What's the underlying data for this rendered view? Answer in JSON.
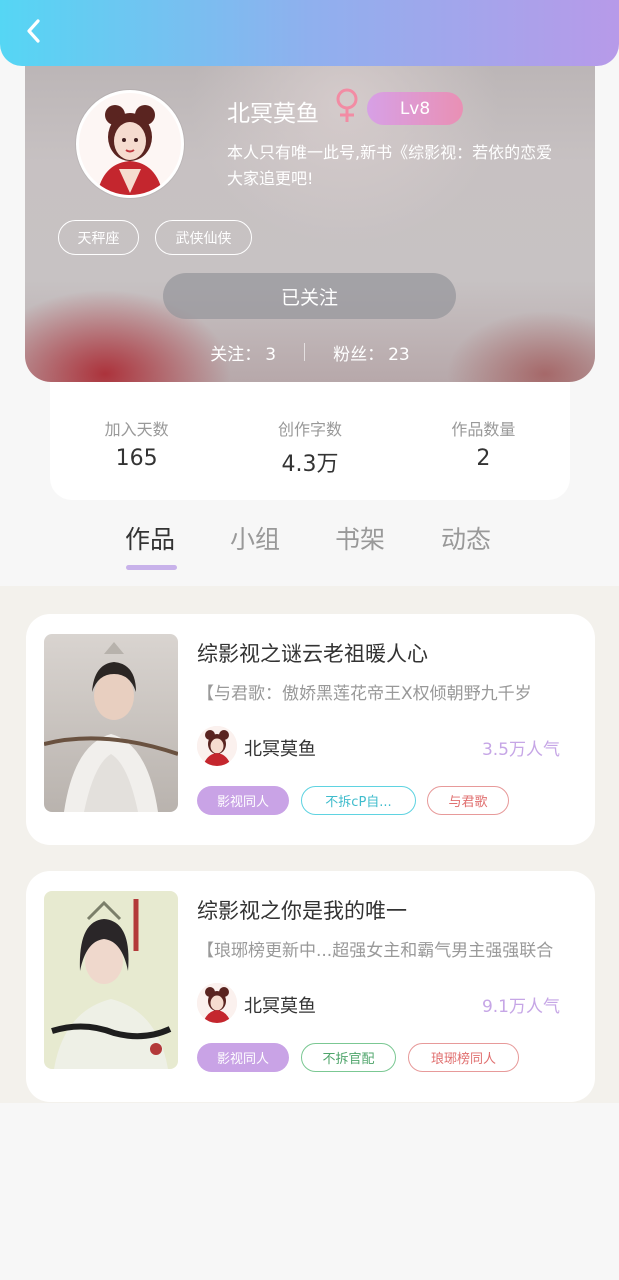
{
  "header": {
    "back_icon": "chevron-left-icon"
  },
  "profile": {
    "name": "北冥莫鱼",
    "gender_icon": "female-icon",
    "gender_color": "#f28ca4",
    "level": "Lv8",
    "bio_line1": "本人只有唯一此号,新书《综影视：若依的恋爱",
    "bio_line2": "大家追更吧!",
    "tags": [
      "天秤座",
      "武侠仙侠"
    ],
    "follow_button": "已关注",
    "following_label": "关注：",
    "following_count": "3",
    "fans_label": "粉丝：",
    "fans_count": "23"
  },
  "stats": [
    {
      "label": "加入天数",
      "value": "165"
    },
    {
      "label": "创作字数",
      "value": "4.3万"
    },
    {
      "label": "作品数量",
      "value": "2"
    }
  ],
  "tabs": [
    "作品",
    "小组",
    "书架",
    "动态"
  ],
  "active_tab": "作品",
  "works": [
    {
      "title": "综影视之谜云老祖暖人心",
      "desc": "【与君歌：傲娇黑莲花帝王X权倾朝野九千岁",
      "author": "北冥莫鱼",
      "popularity": "3.5万人气",
      "tags": [
        "影视同人",
        "不拆cP自...",
        "与君歌"
      ]
    },
    {
      "title": "综影视之你是我的唯一",
      "desc": "【琅琊榜更新中...超强女主和霸气男主强强联合",
      "author": "北冥莫鱼",
      "popularity": "9.1万人气",
      "tags": [
        "影视同人",
        "不拆官配",
        "琅琊榜同人"
      ]
    }
  ],
  "colors": {
    "accent": "#c9a3e6",
    "gradient_start": "#55d6f4",
    "gradient_end": "#b79ae9"
  }
}
